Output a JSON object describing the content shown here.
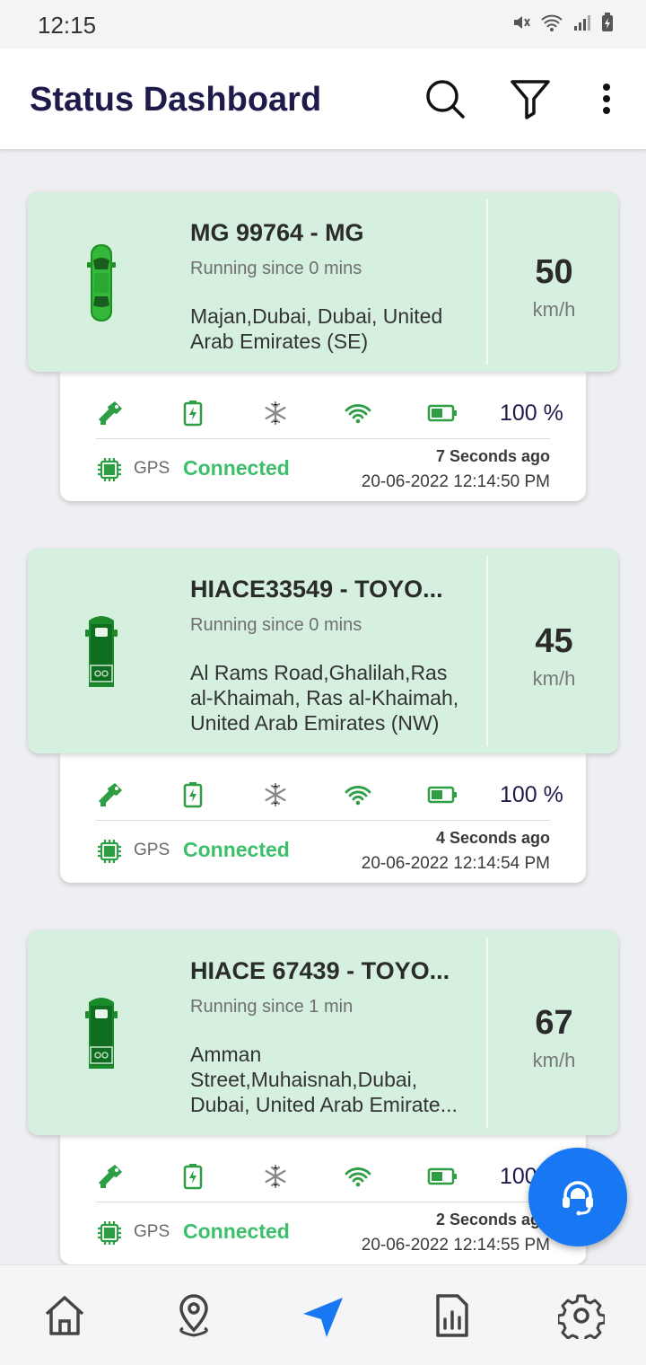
{
  "status_bar": {
    "time": "12:15"
  },
  "header": {
    "title": "Status Dashboard"
  },
  "vehicles": [
    {
      "name": "MG 99764 - MG",
      "running": "Running since 0 mins",
      "address": "Majan,Dubai, Dubai, United Arab Emirates (SE)",
      "speed": "50",
      "unit": "km/h",
      "icon": "car-icon",
      "battery": "100 %",
      "gps_label": "GPS",
      "gps_status": "Connected",
      "ago": "7 Seconds ago",
      "timestamp": "20-06-2022 12:14:50 PM"
    },
    {
      "name": "HIACE33549 - TOYO...",
      "running": "Running since 0 mins",
      "address": "Al Rams Road,Ghalilah,Ras al-Khaimah, Ras al-Khaimah, United Arab Emirates (NW)",
      "speed": "45",
      "unit": "km/h",
      "icon": "van-icon",
      "battery": "100 %",
      "gps_label": "GPS",
      "gps_status": "Connected",
      "ago": "4 Seconds ago",
      "timestamp": "20-06-2022 12:14:54 PM"
    },
    {
      "name": "HIACE 67439 - TOYO...",
      "running": "Running since 1 min",
      "address": "Amman Street,Muhaisnah,Dubai, Dubai, United Arab Emirate...",
      "speed": "67",
      "unit": "km/h",
      "icon": "van-icon",
      "battery": "100 %",
      "gps_label": "GPS",
      "gps_status": "Connected",
      "ago": "2 Seconds ago",
      "timestamp": "20-06-2022 12:14:55 PM"
    }
  ],
  "nav": [
    "home-icon",
    "location-pin-icon",
    "navigation-arrow-icon",
    "report-icon",
    "settings-icon"
  ],
  "colors": {
    "card_top": "#d6f0e0",
    "green": "#3cbf6a",
    "accent_blue": "#1877f2",
    "title": "#1e1b4b"
  }
}
